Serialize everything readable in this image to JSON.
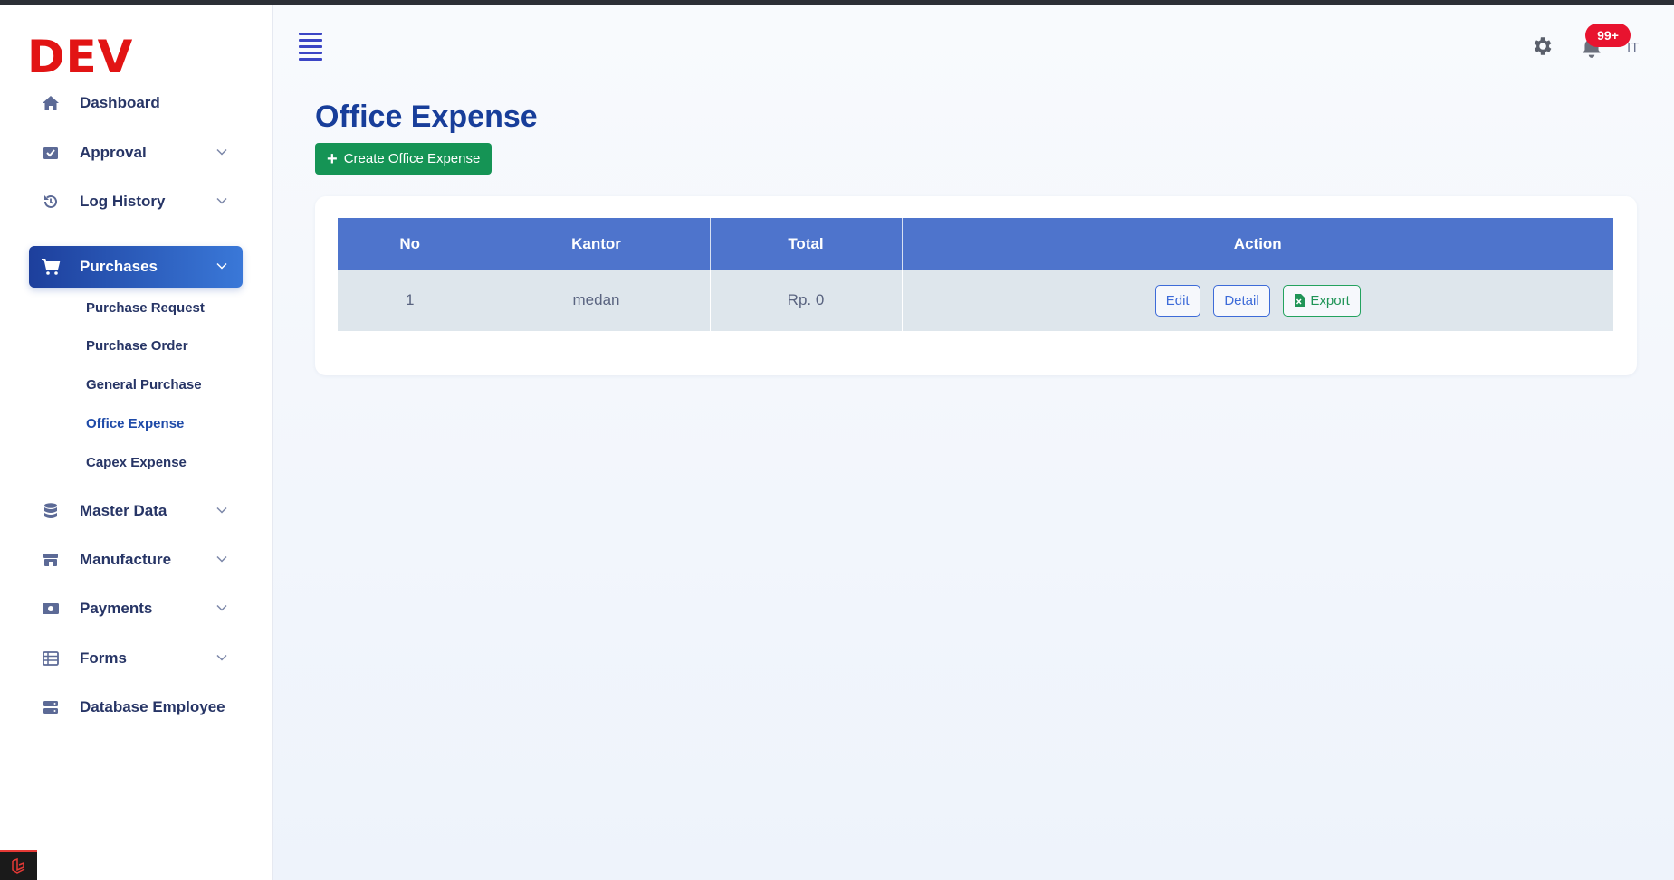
{
  "brand": {
    "logo_text": "DEV",
    "logo_color": "#e21414"
  },
  "sidebar": {
    "items": [
      {
        "label": "Dashboard",
        "icon": "home-icon",
        "has_chevron": false
      },
      {
        "label": "Approval",
        "icon": "inbox-check-icon",
        "has_chevron": true
      },
      {
        "label": "Log History",
        "icon": "history-icon",
        "has_chevron": true
      },
      {
        "label": "Purchases",
        "icon": "cart-icon",
        "has_chevron": true,
        "active": true
      },
      {
        "label": "Master Data",
        "icon": "database-icon",
        "has_chevron": true
      },
      {
        "label": "Manufacture",
        "icon": "store-icon",
        "has_chevron": true
      },
      {
        "label": "Payments",
        "icon": "money-icon",
        "has_chevron": true
      },
      {
        "label": "Forms",
        "icon": "list-icon",
        "has_chevron": true
      },
      {
        "label": "Database Employee",
        "icon": "server-icon",
        "has_chevron": false
      }
    ],
    "purchases_submenu": [
      {
        "label": "Purchase Request"
      },
      {
        "label": "Purchase Order"
      },
      {
        "label": "General Purchase"
      },
      {
        "label": "Office Expense",
        "current": true
      },
      {
        "label": "Capex Expense"
      }
    ]
  },
  "header": {
    "menu_icon": "hamburger-icon",
    "settings_icon": "gear-icon",
    "notifications_icon": "bell-icon",
    "notification_count": "99+",
    "user_initials": "IT"
  },
  "main": {
    "title": "Office Expense",
    "create_button_label": "Create Office Expense",
    "table": {
      "columns": [
        "No",
        "Kantor",
        "Total",
        "Action"
      ],
      "rows": [
        {
          "no": "1",
          "kantor": "medan",
          "total": "Rp. 0"
        }
      ],
      "actions": {
        "edit": "Edit",
        "detail": "Detail",
        "export": "Export"
      }
    }
  },
  "colors": {
    "accent": "#1d3f9c",
    "table_header": "#4e74cc",
    "create_button": "#159455",
    "badge": "#e8132f"
  }
}
